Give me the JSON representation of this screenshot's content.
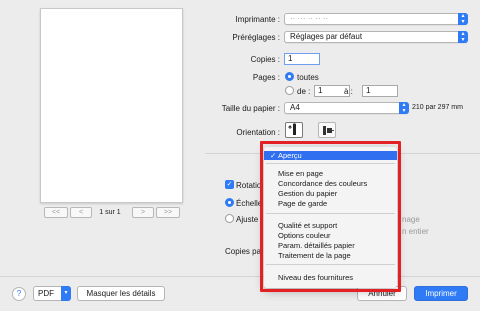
{
  "printer": {
    "label": "Imprimante :",
    "value": "·· ··· ·· ·· ··"
  },
  "presets": {
    "label": "Préréglages :",
    "value": "Réglages par défaut"
  },
  "copies": {
    "label": "Copies :",
    "value": "1"
  },
  "pages": {
    "label": "Pages :",
    "all_label": "toutes",
    "from_label": "de :",
    "from_value": "1",
    "to_label": "à :",
    "to_value": "1"
  },
  "paper_size": {
    "label": "Taille du papier :",
    "value": "A4",
    "dimensions": "210 par 297 mm"
  },
  "orientation": {
    "label": "Orientation :"
  },
  "preview_pager": {
    "first": "<<",
    "prev": "<",
    "page": "1 sur 1",
    "next": ">",
    "last": ">>"
  },
  "partial_controls": {
    "rotation": "Rotatio",
    "scale": "Échelle",
    "fit": "Ajuste",
    "copies_per": "Copies pa",
    "image_suffix": "nage",
    "whole_suffix": "n entier"
  },
  "menu": {
    "selected": "Aperçu",
    "groups": [
      [
        "Mise en page",
        "Concordance des couleurs",
        "Gestion du papier",
        "Page de garde"
      ],
      [
        "Qualité et support",
        "Options couleur",
        "Param. détaillés papier",
        "Traitement de la page"
      ],
      [
        "Niveau des fournitures"
      ]
    ]
  },
  "bottom": {
    "help": "?",
    "pdf": "PDF",
    "hide_details": "Masquer les détails",
    "cancel": "Annuler",
    "print": "Imprimer"
  },
  "colors": {
    "accent": "#2f7bf5",
    "highlight": "#e32125"
  }
}
